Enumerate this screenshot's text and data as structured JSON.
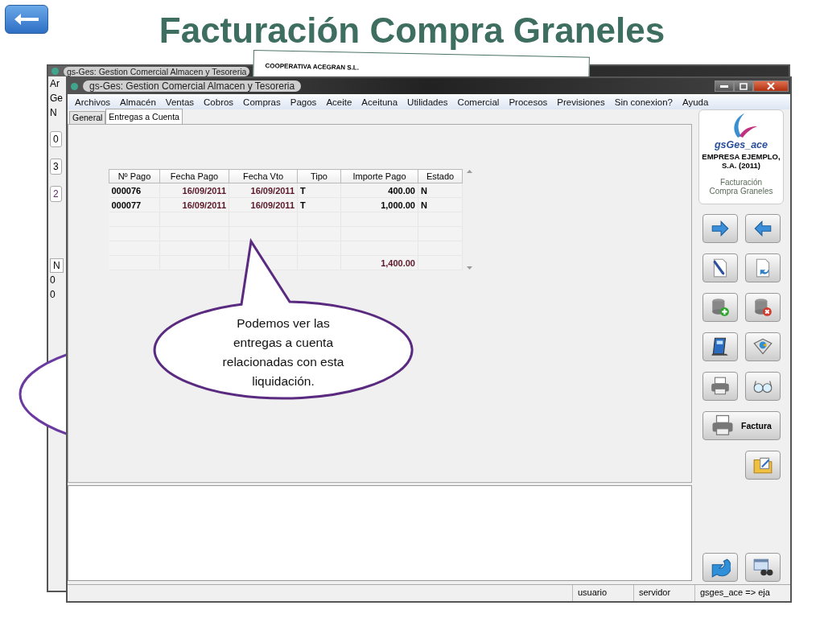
{
  "title": "Facturación Compra Graneles",
  "back_window": {
    "title": "gs-Ges: Gestion Comercial Almacen y Tesoreria",
    "menu": "Ar",
    "tab": "Ge",
    "label": "N",
    "fields": [
      "0",
      "3",
      "2"
    ],
    "grid_header": "N",
    "grid_cells": [
      "0",
      "0"
    ]
  },
  "document": {
    "header": "COOPERATIVA ACEGRAN S.L."
  },
  "window": {
    "title": "gs-Ges: Gestion Comercial Almacen y Tesoreria",
    "menu": [
      "Archivos",
      "Almacén",
      "Ventas",
      "Cobros",
      "Compras",
      "Pagos",
      "Aceite",
      "Aceituna",
      "Utilidades",
      "Comercial",
      "Procesos",
      "Previsiones",
      "Sin conexion?",
      "Ayuda"
    ],
    "tabs": [
      {
        "label": "General",
        "selected": false
      },
      {
        "label": "Entregas a Cuenta",
        "selected": true
      }
    ],
    "table": {
      "columns": [
        "Nº Pago",
        "Fecha Pago",
        "Fecha Vto",
        "Tipo",
        "Importe Pago",
        "Estado"
      ],
      "rows": [
        [
          "000076",
          "16/09/2011",
          "16/09/2011",
          "T",
          "400.00",
          "N"
        ],
        [
          "000077",
          "16/09/2011",
          "16/09/2011",
          "T",
          "1,000.00",
          "N"
        ]
      ],
      "total": "1,400.00"
    },
    "logo": {
      "name": "gsGes_ace",
      "company": "EMPRESA EJEMPLO, S.A. (2011)",
      "module": "Facturación Compra Graneles"
    },
    "print_button": {
      "label": "Factura"
    },
    "status_bar": [
      "usuario",
      "servidor",
      "gsges_ace => eja"
    ]
  },
  "callout": "Podemos ver las entregas a cuenta relacionadas con esta liquidación."
}
